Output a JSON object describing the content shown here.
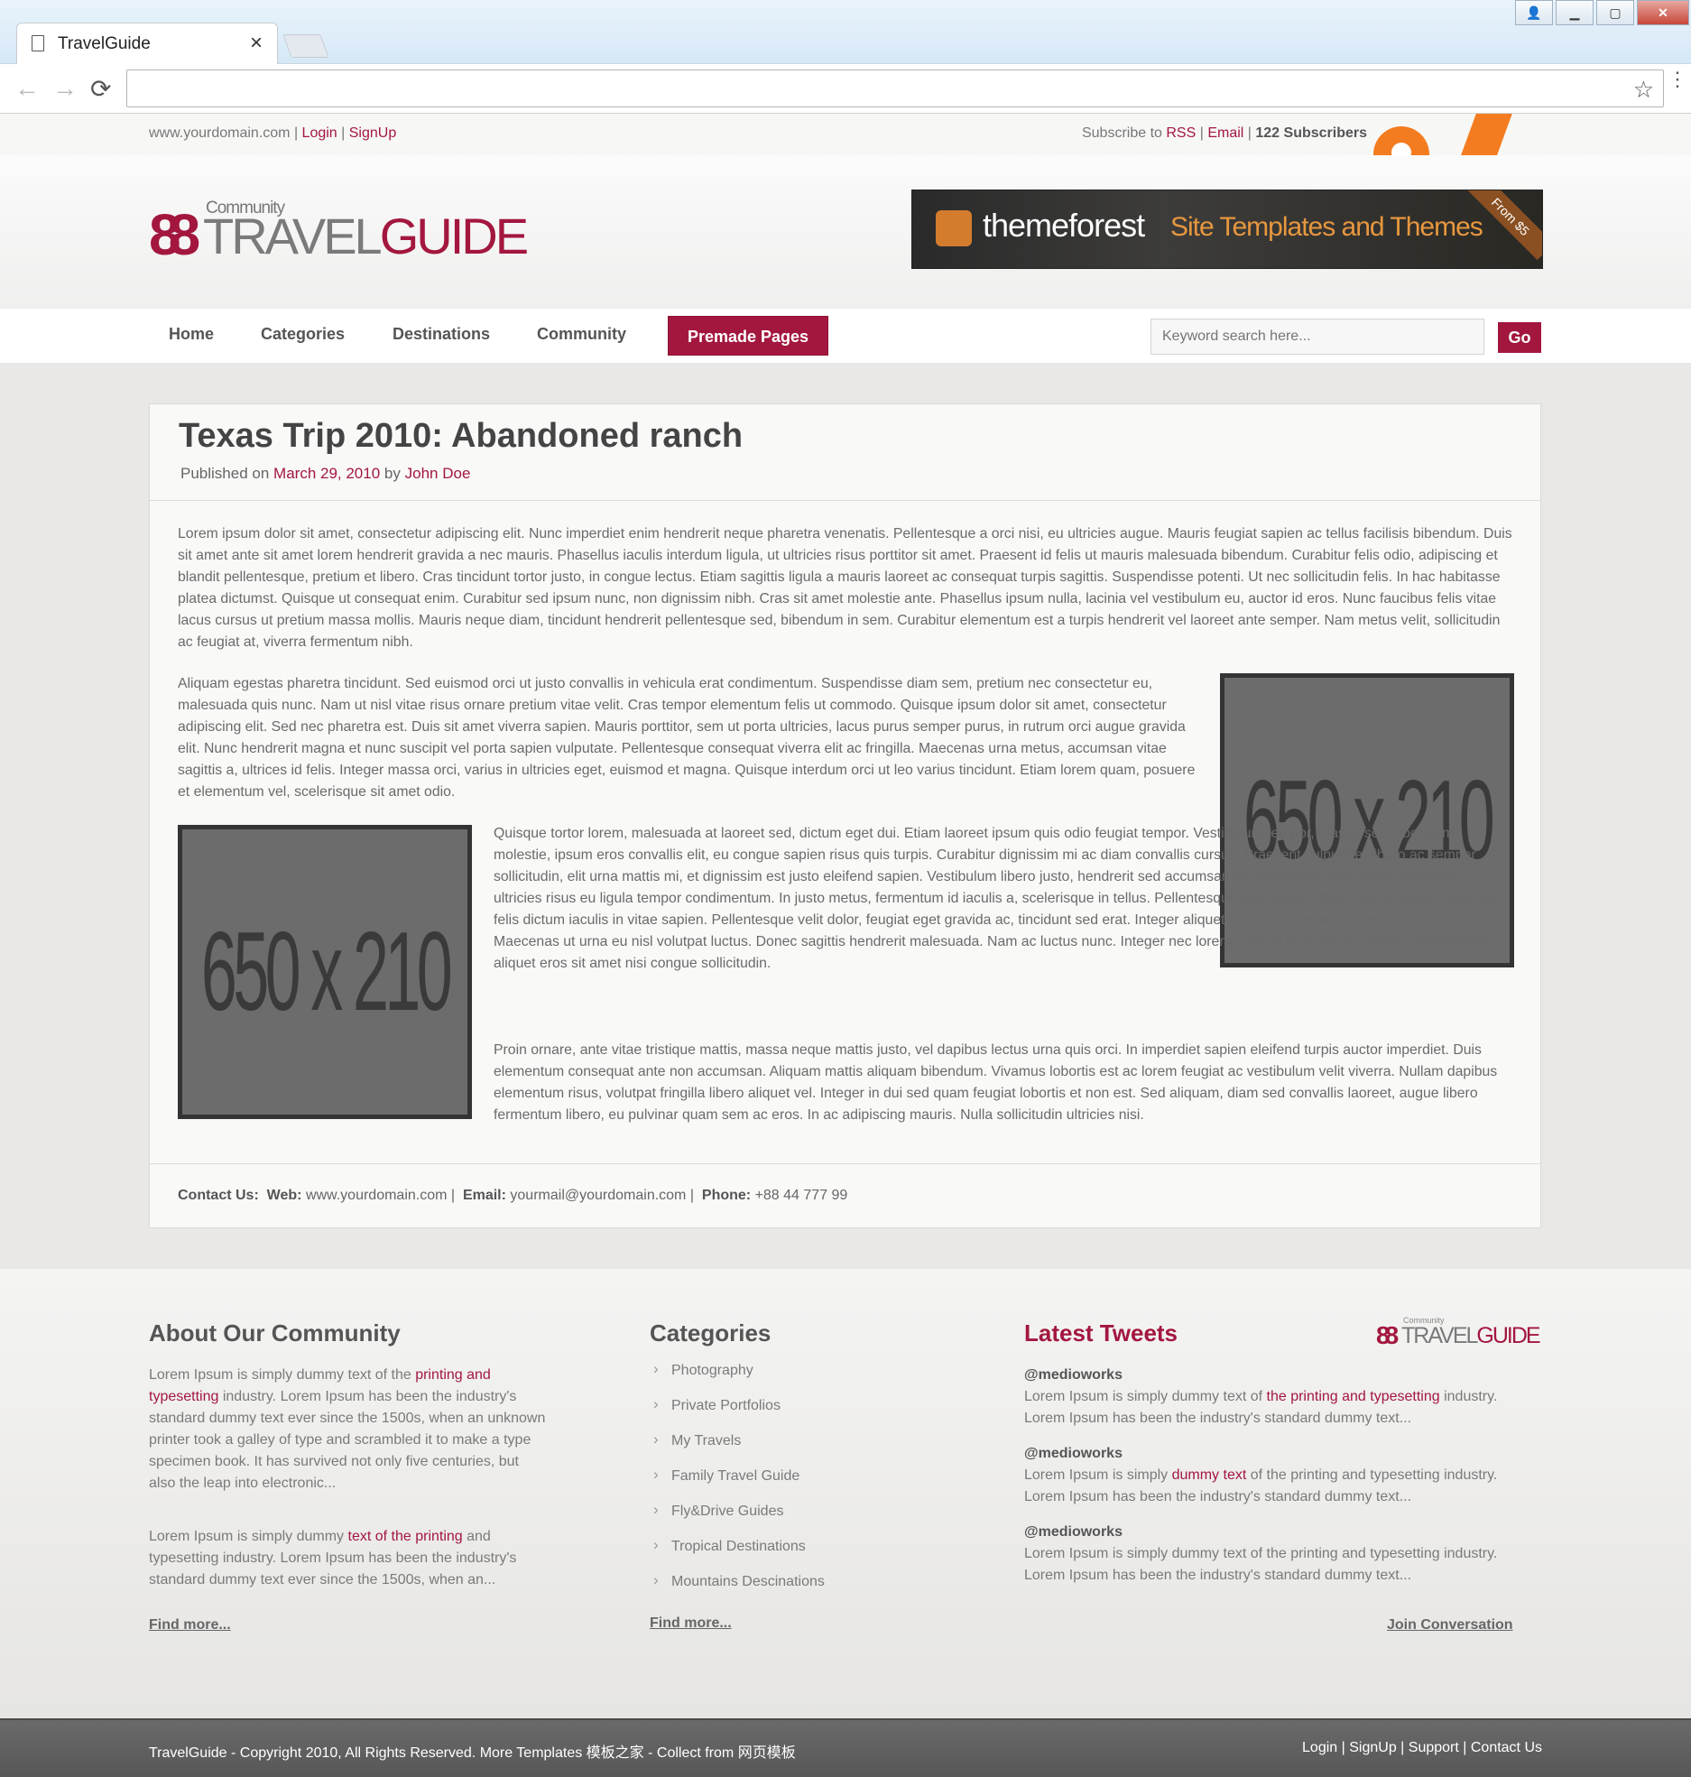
{
  "browser": {
    "tab_title": "TravelGuide",
    "tab_close": "×",
    "back": "←",
    "forward": "→",
    "reload": "⟳",
    "url": "",
    "bookmark": "☆"
  },
  "topbar": {
    "domain": "www.yourdomain.com",
    "login": "Login",
    "signup": "SignUp",
    "subscribe": "Subscribe to",
    "rss": "RSS",
    "email": "Email",
    "subscribers": "122 Subscribers"
  },
  "logo": {
    "mark": "8",
    "community": "Community",
    "travel": "TRAVEL",
    "guide": "GUIDE"
  },
  "banner": {
    "brand": "themeforest",
    "tagline": "Site Templates and Themes",
    "ribbon": "From $5"
  },
  "nav": {
    "home": "Home",
    "categories": "Categories",
    "destinations": "Destinations",
    "community": "Community",
    "premade": "Premade Pages",
    "search_placeholder": "Keyword search here...",
    "go": "Go"
  },
  "article": {
    "title": "Texas Trip 2010: Abandoned ranch",
    "published_prefix": "Published on",
    "date": "March 29, 2010",
    "by": "by",
    "author": "John Doe",
    "p1": "Lorem ipsum dolor sit amet, consectetur adipiscing elit. Nunc imperdiet enim hendrerit neque pharetra venenatis. Pellentesque a orci nisi, eu ultricies augue. Mauris feugiat sapien ac tellus facilisis bibendum. Duis sit amet ante sit amet lorem hendrerit gravida a nec mauris. Phasellus iaculis interdum ligula, ut ultricies risus porttitor sit amet. Praesent id felis ut mauris malesuada bibendum. Curabitur felis odio, adipiscing et blandit pellentesque, pretium et libero. Cras tincidunt tortor justo, in congue lectus. Etiam sagittis ligula a mauris laoreet ac consequat turpis sagittis. Suspendisse potenti. Ut nec sollicitudin felis. In hac habitasse platea dictumst. Quisque ut consequat enim. Curabitur sed ipsum nunc, non dignissim nibh. Cras sit amet molestie ante. Phasellus ipsum nulla, lacinia vel vestibulum eu, auctor id eros. Nunc faucibus felis vitae lacus cursus ut pretium massa mollis. Mauris neque diam, tincidunt hendrerit pellentesque sed, bibendum in sem. Curabitur elementum est a turpis hendrerit vel laoreet ante semper. Nam metus velit, sollicitudin ac feugiat at, viverra fermentum nibh.",
    "p2": "Aliquam egestas pharetra tincidunt. Sed euismod orci ut justo convallis in vehicula erat condimentum. Suspendisse diam sem, pretium nec consectetur eu, malesuada quis nunc. Nam ut nisl vitae risus ornare pretium vitae velit. Cras tempor elementum felis ut commodo. Quisque ipsum dolor sit amet, consectetur adipiscing elit. Sed nec pharetra est. Duis sit amet viverra sapien. Mauris porttitor, sem ut porta ultricies, lacus purus semper purus, in rutrum orci augue gravida elit. Nunc hendrerit magna et nunc suscipit vel porta sapien vulputate. Pellentesque consequat viverra elit ac fringilla. Maecenas urna metus, accumsan vitae sagittis a, ultrices id felis. Integer massa orci, varius in ultricies eget, euismod et magna. Quisque interdum orci ut leo varius tincidunt. Etiam lorem quam, posuere et elementum vel, scelerisque sit amet odio.",
    "p3": "Quisque tortor lorem, malesuada at laoreet sed, dictum eget dui. Etiam laoreet ipsum quis odio feugiat tempor. Vestibulum tempor, massa sed bibendum molestie, ipsum eros convallis elit, eu congue sapien risus quis turpis. Curabitur dignissim mi ac diam convallis cursus. Praesent vulputate, libero ac semper sollicitudin, elit urna mattis mi, et dignissim est justo eleifend sapien. Vestibulum libero justo, hendrerit sed accumsan eu, sollicitudin vitae enim. Phasellus ultricies risus eu ligula tempor condimentum. In justo metus, fermentum id iaculis a, scelerisque in tellus. Pellentesque elementum libero nisl. In dictum enim eu felis dictum iaculis in vitae sapien. Pellentesque velit dolor, feugiat eget gravida ac, tincidunt sed erat. Integer aliquet enim nec metus fermentum interdum. Maecenas ut urna eu nisl volutpat luctus. Donec sagittis hendrerit malesuada. Nam ac luctus nunc. Integer nec lorem eget mi posuere accumsan. Pellentesque aliquet eros sit amet nisi congue sollicitudin.",
    "p4": "Proin ornare, ante vitae tristique mattis, massa neque mattis justo, vel dapibus lectus urna quis orci. In imperdiet sapien eleifend turpis auctor imperdiet. Duis elementum consequat ante non accumsan. Aliquam mattis aliquam bibendum. Vivamus lobortis est ac lorem feugiat ac vestibulum velit viverra. Nullam dapibus elementum risus, volutpat fringilla libero aliquet vel. Integer in dui sed quam feugiat lobortis et non est. Sed aliquam, diam sed convallis laoreet, augue libero fermentum libero, eu pulvinar quam sem ac eros. In ac adipiscing mauris. Nulla sollicitudin ultricies nisi.",
    "image_label": "650 x 210",
    "contact": {
      "label": "Contact Us:",
      "web_label": "Web:",
      "web": "www.yourdomain.com",
      "email_label": "Email:",
      "email": "yourmail@yourdomain.com",
      "phone_label": "Phone:",
      "phone": "+88 44 777 99"
    }
  },
  "footer": {
    "about": {
      "title": "About Our Community",
      "p1_a": "Lorem Ipsum is simply dummy text of the ",
      "p1_link": "printing and typesetting",
      "p1_b": " industry. Lorem Ipsum has been the industry's standard dummy text ever since the 1500s, when an unknown printer took a galley of type and scrambled it to make a type specimen book. It has survived not only five centuries, but also the leap into electronic...",
      "p2_a": "Lorem Ipsum is simply dummy ",
      "p2_link": "text of the printing",
      "p2_b": " and typesetting industry. Lorem Ipsum has been the industry's standard dummy text ever since the 1500s, when an...",
      "find_more": "Find more..."
    },
    "categories": {
      "title": "Categories",
      "items": [
        "Photography",
        "Private Portfolios",
        "My Travels",
        "Family Travel Guide",
        "Fly&Drive Guides",
        "Tropical Destinations",
        "Mountains Descinations"
      ],
      "find_more": "Find more..."
    },
    "tweets": {
      "title": "Latest Tweets",
      "t1_handle": "@medioworks",
      "t1_a": "Lorem Ipsum is simply dummy text of ",
      "t1_link": "the printing and typesetting",
      "t1_b": " industry. Lorem Ipsum has been the industry's standard dummy text...",
      "t2_handle": "@medioworks",
      "t2_a": "Lorem Ipsum is simply ",
      "t2_link": "dummy text",
      "t2_b": " of the printing and typesetting industry. Lorem Ipsum has been the industry's standard dummy text...",
      "t3_handle": "@medioworks",
      "t3_text": "Lorem Ipsum is simply dummy text of the printing and typesetting industry. Lorem Ipsum has been the industry's standard dummy text...",
      "join": "Join Conversation"
    }
  },
  "bottombar": {
    "copyright": "TravelGuide - Copyright 2010, All Rights Reserved. More Templates ",
    "link1": "模板之家",
    "collect": " - Collect from ",
    "link2": "网页模板",
    "login": "Login",
    "signup": "SignUp",
    "support": "Support",
    "contact": "Contact Us"
  }
}
